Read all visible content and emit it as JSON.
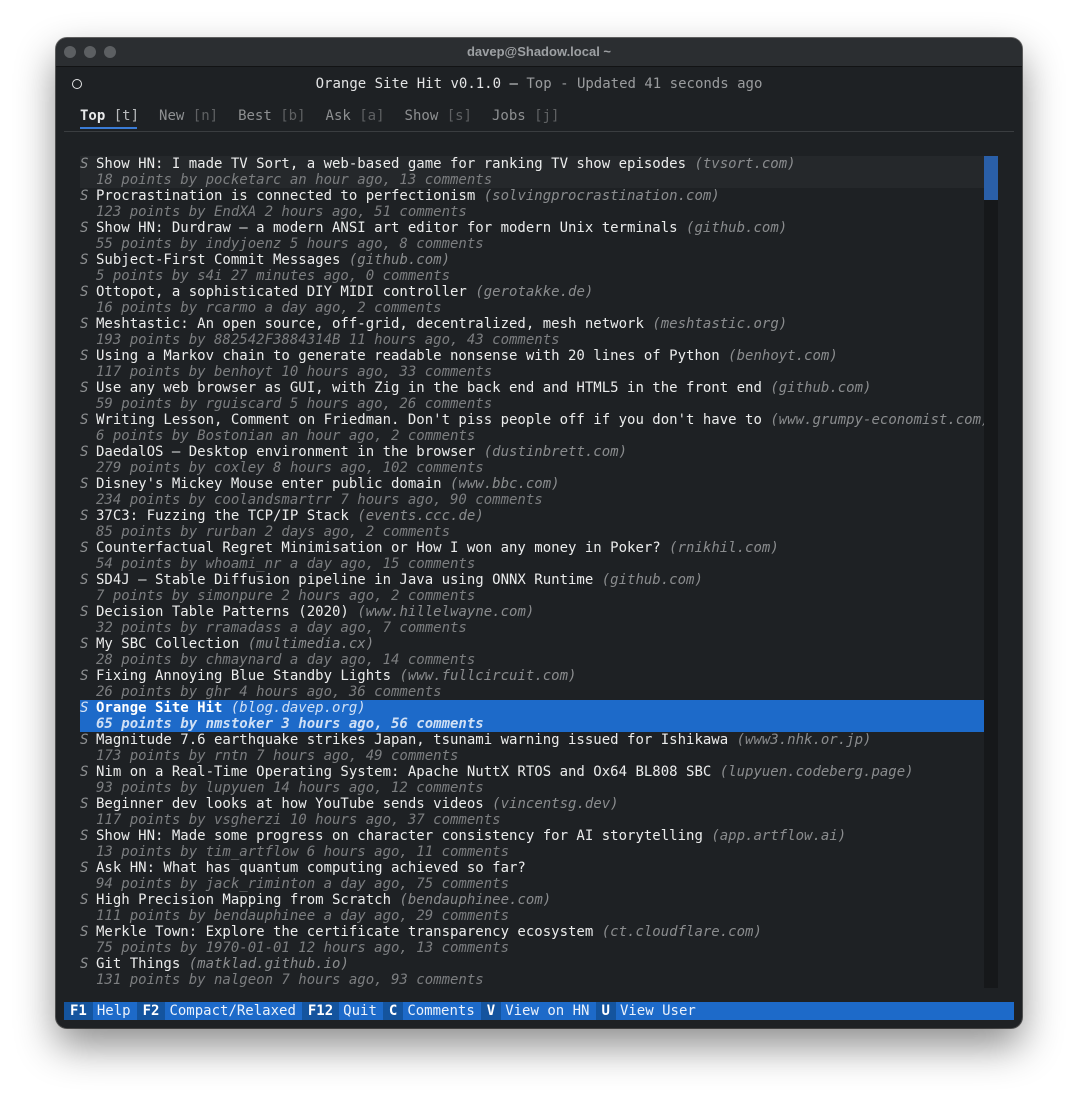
{
  "window": {
    "title": "davep@Shadow.local ~"
  },
  "header": {
    "app": "Orange Site Hit v0.1.0",
    "section": "Top",
    "updated": "Updated 41 seconds ago"
  },
  "tabs": [
    {
      "label": "Top",
      "key": "[t]",
      "active": true
    },
    {
      "label": "New",
      "key": "[n]"
    },
    {
      "label": "Best",
      "key": "[b]"
    },
    {
      "label": "Ask",
      "key": "[a]"
    },
    {
      "label": "Show",
      "key": "[s]"
    },
    {
      "label": "Jobs",
      "key": "[j]"
    }
  ],
  "stories": [
    {
      "marker": "S",
      "title": "Show HN: I made TV Sort, a web-based game for ranking TV show episodes",
      "domain": "(tvsort.com)",
      "meta": "18 points by pocketarc an hour ago, 13 comments",
      "state": "hover"
    },
    {
      "marker": "S",
      "title": "Procrastination is connected to perfectionism",
      "domain": "(solvingprocrastination.com)",
      "meta": "123 points by EndXA 2 hours ago, 51 comments"
    },
    {
      "marker": "S",
      "title": "Show HN: Durdraw – a modern ANSI art editor for modern Unix terminals",
      "domain": "(github.com)",
      "meta": "55 points by indyjoenz 5 hours ago, 8 comments"
    },
    {
      "marker": "S",
      "title": "Subject-First Commit Messages",
      "domain": "(github.com)",
      "meta": "5 points by s4i 27 minutes ago, 0 comments"
    },
    {
      "marker": "S",
      "title": "Ottopot, a sophisticated DIY MIDI controller",
      "domain": "(gerotakke.de)",
      "meta": "16 points by rcarmo a day ago, 2 comments"
    },
    {
      "marker": "S",
      "title": "Meshtastic: An open source, off-grid, decentralized, mesh network",
      "domain": "(meshtastic.org)",
      "meta": "193 points by 882542F3884314B 11 hours ago, 43 comments"
    },
    {
      "marker": "S",
      "title": "Using a Markov chain to generate readable nonsense with 20 lines of Python",
      "domain": "(benhoyt.com)",
      "meta": "117 points by benhoyt 10 hours ago, 33 comments"
    },
    {
      "marker": "S",
      "title": "Use any web browser as GUI, with Zig in the back end and HTML5 in the front end",
      "domain": "(github.com)",
      "meta": "59 points by rguiscard 5 hours ago, 26 comments"
    },
    {
      "marker": "S",
      "title": "Writing Lesson, Comment on Friedman. Don't piss people off if you don't have to",
      "domain": "(www.grumpy-economist.com)",
      "meta": "6 points by Bostonian an hour ago, 2 comments"
    },
    {
      "marker": "S",
      "title": "DaedalOS – Desktop environment in the browser",
      "domain": "(dustinbrett.com)",
      "meta": "279 points by coxley 8 hours ago, 102 comments"
    },
    {
      "marker": "S",
      "title": "Disney's Mickey Mouse enter public domain",
      "domain": "(www.bbc.com)",
      "meta": "234 points by coolandsmartrr 7 hours ago, 90 comments"
    },
    {
      "marker": "S",
      "title": "37C3: Fuzzing the TCP/IP Stack",
      "domain": "(events.ccc.de)",
      "meta": "85 points by rurban 2 days ago, 2 comments"
    },
    {
      "marker": "S",
      "title": "Counterfactual Regret Minimisation or How I won any money in Poker?",
      "domain": "(rnikhil.com)",
      "meta": "54 points by whoami_nr a day ago, 15 comments"
    },
    {
      "marker": "S",
      "title": "SD4J – Stable Diffusion pipeline in Java using ONNX Runtime",
      "domain": "(github.com)",
      "meta": "7 points by simonpure 2 hours ago, 2 comments"
    },
    {
      "marker": "S",
      "title": "Decision Table Patterns (2020)",
      "domain": "(www.hillelwayne.com)",
      "meta": "32 points by rramadass a day ago, 7 comments"
    },
    {
      "marker": "S",
      "title": "My SBC Collection",
      "domain": "(multimedia.cx)",
      "meta": "28 points by chmaynard a day ago, 14 comments"
    },
    {
      "marker": "S",
      "title": "Fixing Annoying Blue Standby Lights",
      "domain": "(www.fullcircuit.com)",
      "meta": "26 points by ghr 4 hours ago, 36 comments"
    },
    {
      "marker": "S",
      "title": "Orange Site Hit",
      "domain": "(blog.davep.org)",
      "meta": "65 points by nmstoker 3 hours ago, 56 comments",
      "state": "selected"
    },
    {
      "marker": "S",
      "title": "Magnitude 7.6 earthquake strikes Japan, tsunami warning issued for Ishikawa",
      "domain": "(www3.nhk.or.jp)",
      "meta": "173 points by rntn 7 hours ago, 49 comments"
    },
    {
      "marker": "S",
      "title": "Nim on a Real-Time Operating System: Apache NuttX RTOS and Ox64 BL808 SBC",
      "domain": "(lupyuen.codeberg.page)",
      "meta": "93 points by lupyuen 14 hours ago, 12 comments"
    },
    {
      "marker": "S",
      "title": "Beginner dev looks at how YouTube sends videos",
      "domain": "(vincentsg.dev)",
      "meta": "117 points by vsgherzi 10 hours ago, 37 comments"
    },
    {
      "marker": "S",
      "title": "Show HN: Made some progress on character consistency for AI storytelling",
      "domain": "(app.artflow.ai)",
      "meta": "13 points by tim_artflow 6 hours ago, 11 comments"
    },
    {
      "marker": "S",
      "title": "Ask HN: What has quantum computing achieved so far?",
      "domain": "",
      "meta": "94 points by jack_riminton a day ago, 75 comments"
    },
    {
      "marker": "S",
      "title": "High Precision Mapping from Scratch",
      "domain": "(bendauphinee.com)",
      "meta": "111 points by bendauphinee a day ago, 29 comments"
    },
    {
      "marker": "S",
      "title": "Merkle Town: Explore the certificate transparency ecosystem",
      "domain": "(ct.cloudflare.com)",
      "meta": "75 points by 1970-01-01 12 hours ago, 13 comments"
    },
    {
      "marker": "S",
      "title": "Git Things",
      "domain": "(matklad.github.io)",
      "meta": "131 points by nalgeon 7 hours ago, 93 comments"
    }
  ],
  "footer": [
    {
      "key": "F1",
      "label": "Help"
    },
    {
      "key": "F2",
      "label": "Compact/Relaxed"
    },
    {
      "key": "F12",
      "label": "Quit"
    },
    {
      "key": "C",
      "label": "Comments"
    },
    {
      "key": "V",
      "label": "View on HN"
    },
    {
      "key": "U",
      "label": "View User"
    }
  ],
  "scrollbar": {
    "position": 0
  }
}
